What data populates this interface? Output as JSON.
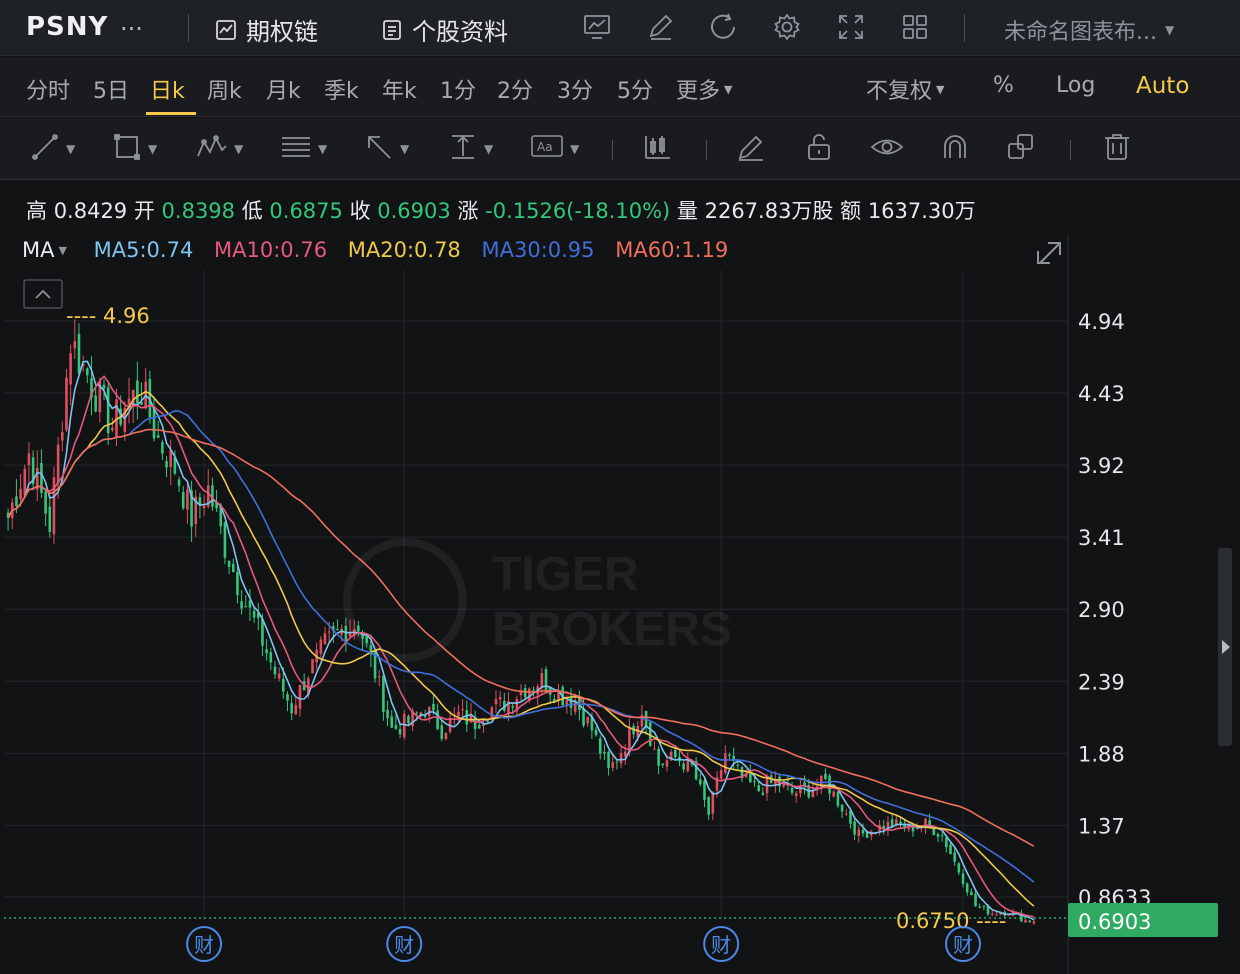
{
  "top": {
    "ticker": "PSNY",
    "ticker_more": "...",
    "option_chain": "期权链",
    "stock_info": "个股资料",
    "chart_name": "未命名图表布...",
    "icons": [
      "line-chart-icon",
      "edit-icon",
      "refresh-icon",
      "gear-icon",
      "fullscreen-icon",
      "layout-grid-icon"
    ]
  },
  "periods": {
    "items": [
      "分时",
      "5日",
      "日k",
      "周k",
      "月k",
      "季k",
      "年k",
      "1分",
      "2分",
      "3分",
      "5分",
      "更多"
    ],
    "active": "日k",
    "adjust": "不复权",
    "percent": "%",
    "log": "Log",
    "auto": "Auto"
  },
  "tools": [
    "trend-line-icon",
    "rectangle-icon",
    "pattern-icon",
    "fib-icon",
    "arrow-icon",
    "range-icon",
    "text-icon",
    "candle-type-icon",
    "pencil-icon",
    "unlock-icon",
    "eye-icon",
    "magnet-icon",
    "clone-icon",
    "trash-icon"
  ],
  "ohlc": {
    "high_label": "高",
    "high": "0.8429",
    "open_label": "开",
    "open": "0.8398",
    "low_label": "低",
    "low": "0.6875",
    "close_label": "收",
    "close": "0.6903",
    "change_label": "涨",
    "change": "-0.1526(-18.10%)",
    "vol_label": "量",
    "vol": "2267.83万股",
    "amt_label": "额",
    "amt": "1637.30万"
  },
  "ma": {
    "label": "MA",
    "ma5": "MA5:0.74",
    "ma10": "MA10:0.76",
    "ma20": "MA20:0.78",
    "ma30": "MA30:0.95",
    "ma60": "MA60:1.19",
    "colors": {
      "ma5": "#7fc3ef",
      "ma10": "#e7587d",
      "ma20": "#f0c84a",
      "ma30": "#3f6fd8",
      "ma60": "#ef6f5a"
    }
  },
  "watermark": [
    "TIGER",
    "BROKERS"
  ],
  "chart_data": {
    "type": "candlestick",
    "y_ticks": [
      "4.94",
      "4.43",
      "3.92",
      "3.41",
      "2.90",
      "2.39",
      "1.88",
      "1.37",
      "0.8633"
    ],
    "y_tick_values": [
      4.94,
      4.43,
      3.92,
      3.41,
      2.9,
      2.39,
      1.88,
      1.37,
      0.8633
    ],
    "ylim": [
      0.66,
      5.0
    ],
    "high_marker": "4.96",
    "low_marker": "0.6750",
    "last_price": "0.6903",
    "last_value": 0.6903,
    "earnings_marker": "财",
    "earnings_index": [
      47,
      95,
      171,
      229
    ],
    "up_color": "#e04f5f",
    "down_color": "#34c77b",
    "trend": [
      [
        0,
        3.55
      ],
      [
        5,
        4.0
      ],
      [
        10,
        3.5
      ],
      [
        15,
        4.8
      ],
      [
        20,
        4.5
      ],
      [
        25,
        4.2
      ],
      [
        28,
        4.35
      ],
      [
        32,
        4.45
      ],
      [
        36,
        4.1
      ],
      [
        40,
        3.9
      ],
      [
        44,
        3.55
      ],
      [
        48,
        3.75
      ],
      [
        52,
        3.35
      ],
      [
        56,
        3.0
      ],
      [
        60,
        2.75
      ],
      [
        64,
        2.45
      ],
      [
        68,
        2.2
      ],
      [
        72,
        2.45
      ],
      [
        76,
        2.65
      ],
      [
        80,
        2.75
      ],
      [
        84,
        2.8
      ],
      [
        88,
        2.45
      ],
      [
        92,
        2.05
      ],
      [
        96,
        2.1
      ],
      [
        100,
        2.2
      ],
      [
        104,
        2.05
      ],
      [
        108,
        2.15
      ],
      [
        112,
        2.1
      ],
      [
        116,
        2.2
      ],
      [
        120,
        2.25
      ],
      [
        124,
        2.35
      ],
      [
        128,
        2.4
      ],
      [
        132,
        2.3
      ],
      [
        136,
        2.25
      ],
      [
        140,
        2.05
      ],
      [
        144,
        1.75
      ],
      [
        148,
        1.95
      ],
      [
        152,
        2.2
      ],
      [
        156,
        1.8
      ],
      [
        160,
        1.85
      ],
      [
        164,
        1.78
      ],
      [
        168,
        1.45
      ],
      [
        172,
        1.88
      ],
      [
        176,
        1.7
      ],
      [
        180,
        1.62
      ],
      [
        184,
        1.68
      ],
      [
        188,
        1.6
      ],
      [
        192,
        1.62
      ],
      [
        196,
        1.68
      ],
      [
        200,
        1.5
      ],
      [
        204,
        1.3
      ],
      [
        208,
        1.35
      ],
      [
        212,
        1.38
      ],
      [
        216,
        1.35
      ],
      [
        220,
        1.38
      ],
      [
        224,
        1.3
      ],
      [
        228,
        1.05
      ],
      [
        232,
        0.8
      ],
      [
        236,
        0.75
      ],
      [
        240,
        0.76
      ],
      [
        244,
        0.7
      ],
      [
        246,
        0.69
      ]
    ]
  }
}
